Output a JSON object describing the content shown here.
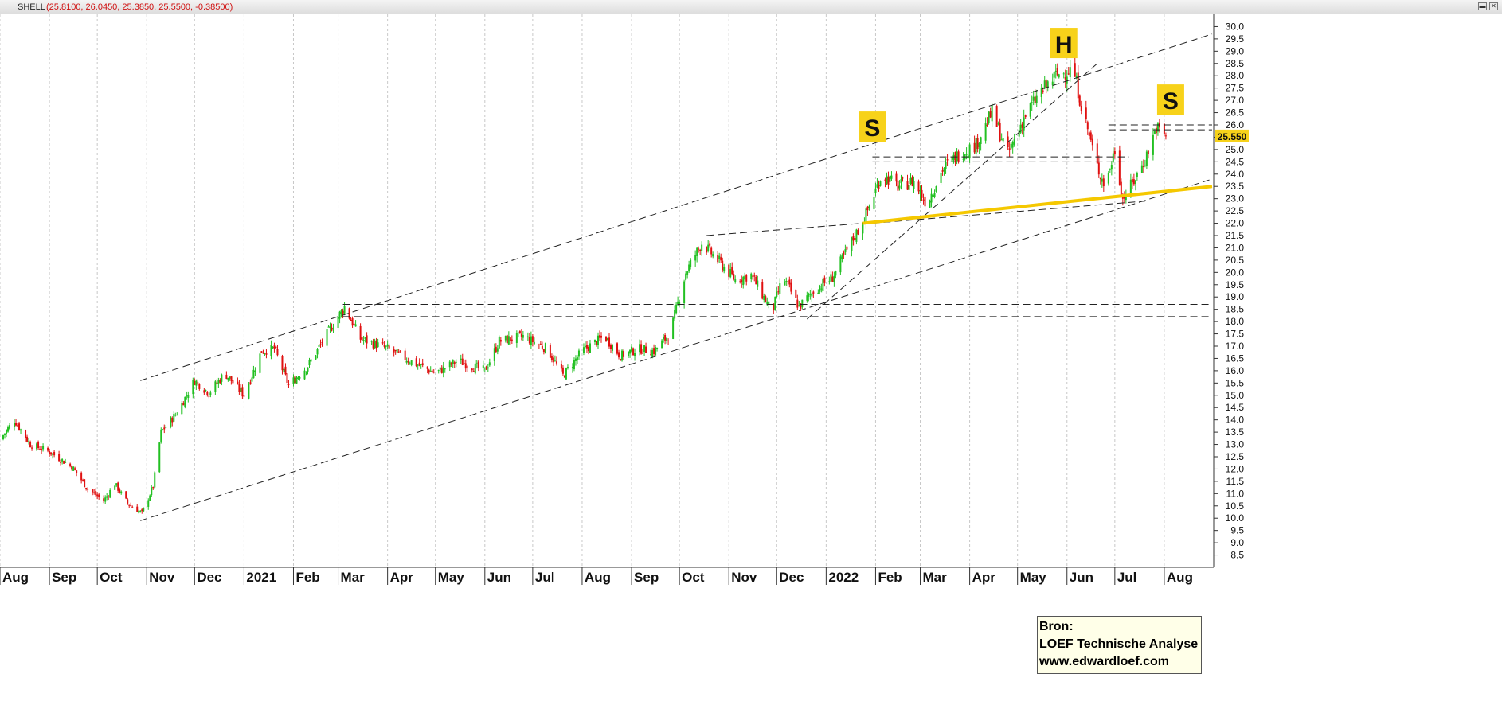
{
  "header": {
    "symbol": "SHELL",
    "ohlc": "(25.8100, 26.0450, 25.3850, 25.5500, -0.38500)",
    "buttons": [
      "min-icon",
      "close-icon"
    ]
  },
  "source_box": {
    "line1": "Bron:",
    "line2": "LOEF Technische Analyse",
    "line3": "www.edwardloef.com"
  },
  "chart_data": {
    "type": "candlestick",
    "symbol": "SHELL",
    "period": "daily",
    "x_start": "2020-08-01",
    "x_end": "2022-08-31",
    "ylim": [
      8.0,
      30.5
    ],
    "y_ticks": [
      8.5,
      9.0,
      9.5,
      10.0,
      10.5,
      11.0,
      11.5,
      12.0,
      12.5,
      13.0,
      13.5,
      14.0,
      14.5,
      15.0,
      15.5,
      16.0,
      16.5,
      17.0,
      17.5,
      18.0,
      18.5,
      19.0,
      19.5,
      20.0,
      20.5,
      21.0,
      21.5,
      22.0,
      22.5,
      23.0,
      23.5,
      24.0,
      24.5,
      25.0,
      25.5,
      26.0,
      26.5,
      27.0,
      27.5,
      28.0,
      28.5,
      29.0,
      29.5,
      30.0
    ],
    "month_labels": [
      {
        "date": "2020-08-01",
        "label": "Aug"
      },
      {
        "date": "2020-09-01",
        "label": "Sep"
      },
      {
        "date": "2020-10-01",
        "label": "Oct"
      },
      {
        "date": "2020-11-01",
        "label": "Nov"
      },
      {
        "date": "2020-12-01",
        "label": "Dec"
      },
      {
        "date": "2021-01-01",
        "label": "2021"
      },
      {
        "date": "2021-02-01",
        "label": "Feb"
      },
      {
        "date": "2021-03-01",
        "label": "Mar"
      },
      {
        "date": "2021-04-01",
        "label": "Apr"
      },
      {
        "date": "2021-05-01",
        "label": "May"
      },
      {
        "date": "2021-06-01",
        "label": "Jun"
      },
      {
        "date": "2021-07-01",
        "label": "Jul"
      },
      {
        "date": "2021-08-01",
        "label": "Aug"
      },
      {
        "date": "2021-09-01",
        "label": "Sep"
      },
      {
        "date": "2021-10-01",
        "label": "Oct"
      },
      {
        "date": "2021-11-01",
        "label": "Nov"
      },
      {
        "date": "2021-12-01",
        "label": "Dec"
      },
      {
        "date": "2022-01-01",
        "label": "2022"
      },
      {
        "date": "2022-02-01",
        "label": "Feb"
      },
      {
        "date": "2022-03-01",
        "label": "Mar"
      },
      {
        "date": "2022-04-01",
        "label": "Apr"
      },
      {
        "date": "2022-05-01",
        "label": "May"
      },
      {
        "date": "2022-06-01",
        "label": "Jun"
      },
      {
        "date": "2022-07-01",
        "label": "Jul"
      },
      {
        "date": "2022-08-01",
        "label": "Aug"
      }
    ],
    "close_path": [
      [
        "2020-08-01",
        13.2
      ],
      [
        "2020-08-10",
        14.0
      ],
      [
        "2020-08-20",
        13.0
      ],
      [
        "2020-09-01",
        12.7
      ],
      [
        "2020-09-15",
        12.1
      ],
      [
        "2020-09-25",
        11.2
      ],
      [
        "2020-10-05",
        10.7
      ],
      [
        "2020-10-12",
        11.4
      ],
      [
        "2020-10-20",
        10.6
      ],
      [
        "2020-10-29",
        10.2
      ],
      [
        "2020-11-05",
        11.3
      ],
      [
        "2020-11-10",
        13.5
      ],
      [
        "2020-11-20",
        14.3
      ],
      [
        "2020-12-01",
        15.6
      ],
      [
        "2020-12-10",
        15.1
      ],
      [
        "2020-12-20",
        15.9
      ],
      [
        "2021-01-01",
        15.0
      ],
      [
        "2021-01-12",
        16.8
      ],
      [
        "2021-01-20",
        16.9
      ],
      [
        "2021-01-29",
        15.4
      ],
      [
        "2021-02-10",
        16.2
      ],
      [
        "2021-02-25",
        17.8
      ],
      [
        "2021-03-05",
        18.6
      ],
      [
        "2021-03-15",
        17.3
      ],
      [
        "2021-04-01",
        16.9
      ],
      [
        "2021-04-15",
        16.4
      ],
      [
        "2021-05-01",
        15.9
      ],
      [
        "2021-05-15",
        16.4
      ],
      [
        "2021-06-01",
        16.0
      ],
      [
        "2021-06-10",
        17.2
      ],
      [
        "2021-06-25",
        17.4
      ],
      [
        "2021-07-10",
        16.9
      ],
      [
        "2021-07-20",
        15.8
      ],
      [
        "2021-08-01",
        16.8
      ],
      [
        "2021-08-15",
        17.4
      ],
      [
        "2021-08-25",
        16.6
      ],
      [
        "2021-09-05",
        16.9
      ],
      [
        "2021-09-15",
        16.8
      ],
      [
        "2021-09-25",
        17.5
      ],
      [
        "2021-10-05",
        20.0
      ],
      [
        "2021-10-15",
        21.2
      ],
      [
        "2021-10-25",
        20.5
      ],
      [
        "2021-11-05",
        19.7
      ],
      [
        "2021-11-15",
        19.9
      ],
      [
        "2021-11-28",
        18.4
      ],
      [
        "2021-12-05",
        19.8
      ],
      [
        "2021-12-15",
        18.6
      ],
      [
        "2021-12-25",
        19.3
      ],
      [
        "2022-01-05",
        19.8
      ],
      [
        "2022-01-15",
        21.0
      ],
      [
        "2022-01-25",
        22.2
      ],
      [
        "2022-02-05",
        24.0
      ],
      [
        "2022-02-15",
        23.5
      ],
      [
        "2022-02-25",
        23.7
      ],
      [
        "2022-03-05",
        22.8
      ],
      [
        "2022-03-15",
        24.2
      ],
      [
        "2022-03-25",
        24.8
      ],
      [
        "2022-04-05",
        25.2
      ],
      [
        "2022-04-15",
        26.5
      ],
      [
        "2022-04-25",
        24.8
      ],
      [
        "2022-05-05",
        26.3
      ],
      [
        "2022-05-15",
        27.3
      ],
      [
        "2022-05-25",
        28.0
      ],
      [
        "2022-06-05",
        28.3
      ],
      [
        "2022-06-10",
        26.8
      ],
      [
        "2022-06-20",
        24.3
      ],
      [
        "2022-06-25",
        23.5
      ],
      [
        "2022-07-01",
        25.0
      ],
      [
        "2022-07-06",
        23.0
      ],
      [
        "2022-07-12",
        23.6
      ],
      [
        "2022-07-20",
        24.6
      ],
      [
        "2022-07-27",
        25.9
      ],
      [
        "2022-08-02",
        25.55
      ]
    ],
    "last_value": 25.55,
    "last_value_label": "25.550",
    "trendlines": [
      {
        "style": "dashed",
        "from": [
          "2020-10-28",
          15.6
        ],
        "to": [
          "2022-08-31",
          29.7
        ]
      },
      {
        "style": "dashed",
        "from": [
          "2020-10-28",
          9.9
        ],
        "to": [
          "2022-08-31",
          23.8
        ]
      },
      {
        "style": "dashed",
        "from": [
          "2021-03-04",
          18.7
        ],
        "to": [
          "2022-08-31",
          18.7
        ]
      },
      {
        "style": "dashed",
        "from": [
          "2021-03-04",
          18.2
        ],
        "to": [
          "2022-08-31",
          18.2
        ]
      },
      {
        "style": "dashed",
        "from": [
          "2021-12-20",
          18.1
        ],
        "to": [
          "2022-06-20",
          28.5
        ]
      },
      {
        "style": "dashed",
        "from": [
          "2021-10-18",
          21.5
        ],
        "to": [
          "2022-01-24",
          22.0
        ]
      },
      {
        "style": "dashed",
        "from": [
          "2022-01-30",
          24.7
        ],
        "to": [
          "2022-07-10",
          24.7
        ]
      },
      {
        "style": "dashed",
        "from": [
          "2022-01-30",
          24.5
        ],
        "to": [
          "2022-07-10",
          24.5
        ]
      },
      {
        "style": "dashed",
        "from": [
          "2022-06-27",
          26.0
        ],
        "to": [
          "2022-08-31",
          26.0
        ]
      },
      {
        "style": "dashed",
        "from": [
          "2022-06-27",
          25.8
        ],
        "to": [
          "2022-08-31",
          25.8
        ]
      },
      {
        "style": "dashed",
        "from": [
          "2022-01-30",
          22.0
        ],
        "to": [
          "2022-07-20",
          22.9
        ]
      },
      {
        "style": "solid-yellow",
        "from": [
          "2022-01-24",
          22.0
        ],
        "to": [
          "2022-08-31",
          23.5
        ]
      }
    ],
    "annotations": [
      {
        "text": "S",
        "date": "2022-01-30",
        "value": 25.9
      },
      {
        "text": "H",
        "date": "2022-05-30",
        "value": 29.3
      },
      {
        "text": "S",
        "date": "2022-08-05",
        "value": 27.0
      }
    ]
  }
}
